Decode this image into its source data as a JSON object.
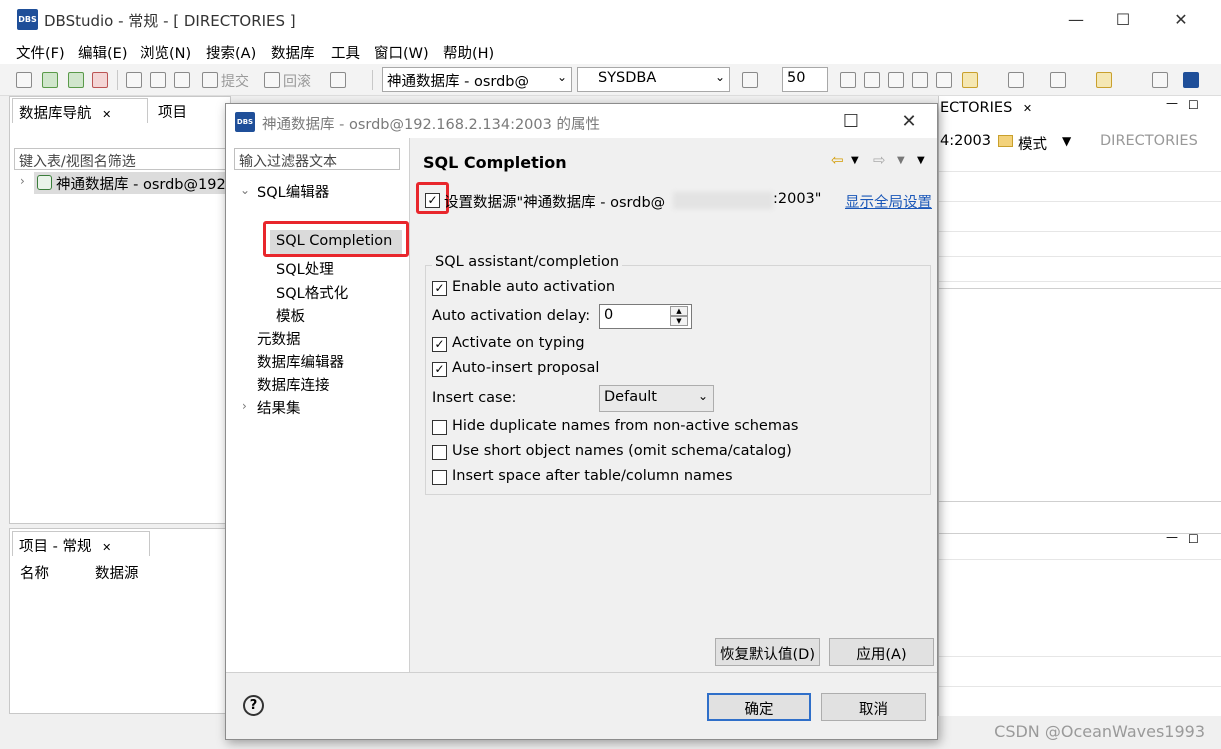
{
  "window": {
    "app_icon": "DBS",
    "title": "DBStudio - 常规 - [ DIRECTORIES ]",
    "minimize": "—",
    "maximize": "☐",
    "close": "✕"
  },
  "menu": [
    "文件(F)",
    "编辑(E)",
    "浏览(N)",
    "搜索(A)",
    "数据库",
    "工具",
    "窗口(W)",
    "帮助(H)"
  ],
  "toolbar": {
    "commit_label": "提交",
    "rollback_label": "回滚",
    "datasource_combo": "神通数据库 - osrdb@",
    "user_combo": "SYSDBA",
    "fetch_size": "50"
  },
  "nav_panel": {
    "tab_label": "数据库导航",
    "tab2_label": "项目",
    "filter_placeholder": "键入表/视图名筛选",
    "tree_item": "神通数据库 - osrdb@192"
  },
  "proj_panel": {
    "tab_label": "项目 - 常规",
    "col_name": "名称",
    "col_datasource": "数据源"
  },
  "editor_bg": {
    "tab_label": "ECTORIES",
    "conn_text": "4:2003",
    "schema_label": "模式",
    "schema_value": "DIRECTORIES"
  },
  "dialog": {
    "icon": "DBS",
    "title": "神通数据库 - osrdb@192.168.2.134:2003 的属性",
    "maximize": "☐",
    "close": "✕",
    "filter_placeholder": "输入过滤器文本",
    "tree": {
      "sql_editor": "SQL编辑器",
      "sql_completion": "SQL Completion",
      "sql_processing": "SQL处理",
      "sql_format": "SQL格式化",
      "template": "模板",
      "metadata": "元数据",
      "db_editor": "数据库编辑器",
      "db_connection": "数据库连接",
      "result_set": "结果集"
    },
    "page_title": "SQL Completion",
    "datasource_setting": "设置数据源\"神通数据库 - osrdb@",
    "datasource_port": ":2003\"",
    "show_global": "显示全局设置",
    "group_title": "SQL assistant/completion",
    "enable_auto": "Enable auto activation",
    "auto_delay_label": "Auto activation delay:",
    "auto_delay_value": "0",
    "activate_typing": "Activate on typing",
    "auto_insert": "Auto-insert proposal",
    "insert_case_label": "Insert case:",
    "insert_case_value": "Default",
    "hide_duplicates": "Hide duplicate names from non-active schemas",
    "short_names": "Use short object names (omit schema/catalog)",
    "insert_space": "Insert space after table/column names",
    "restore_defaults": "恢复默认值(D)",
    "apply": "应用(A)",
    "ok": "确定",
    "cancel": "取消",
    "help": "?"
  },
  "watermark": "CSDN @OceanWaves1993",
  "colors": {
    "accent_red": "#e8262c",
    "link_blue": "#1a57b8",
    "brand_blue": "#1f4f99"
  }
}
